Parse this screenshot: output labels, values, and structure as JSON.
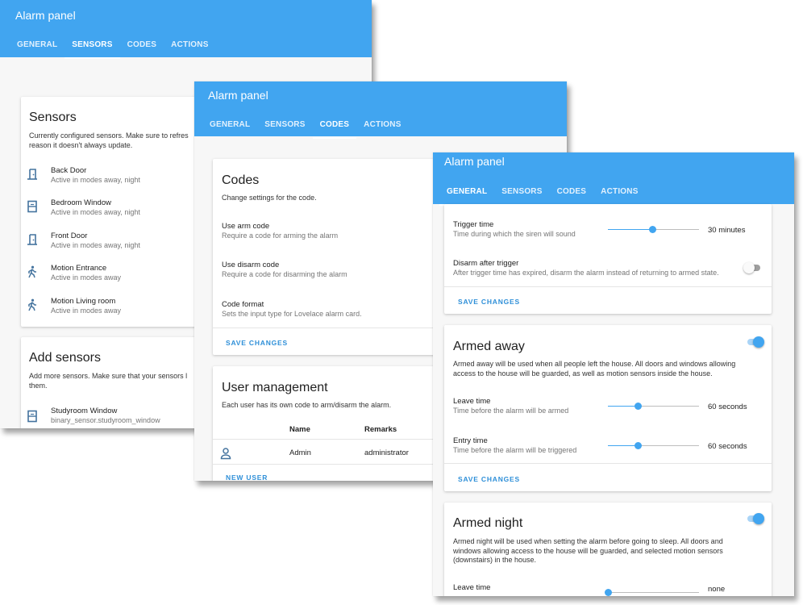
{
  "colors": {
    "primary": "#41a5f0",
    "accent": "#2e8fd8",
    "background": "#f7f7f7"
  },
  "sensors_window": {
    "title": "Alarm panel",
    "tabs": [
      "GENERAL",
      "SENSORS",
      "CODES",
      "ACTIONS"
    ],
    "active_tab": "SENSORS",
    "sensors_card": {
      "title": "Sensors",
      "description_1": "Currently configured sensors. Make sure to refres",
      "description_2": "reason it doesn't always update.",
      "items": [
        {
          "name": "Back Door",
          "info": "Active in modes away, night",
          "icon": "door-icon"
        },
        {
          "name": "Bedroom Window",
          "info": "Active in modes away, night",
          "icon": "window-icon"
        },
        {
          "name": "Front Door",
          "info": "Active in modes away, night",
          "icon": "door-icon"
        },
        {
          "name": "Motion Entrance",
          "info": "Active in modes away",
          "icon": "walk-icon"
        },
        {
          "name": "Motion Living room",
          "info": "Active in modes away",
          "icon": "walk-icon"
        }
      ]
    },
    "add_card": {
      "title": "Add sensors",
      "description_1": "Add more sensors. Make sure that your sensors l",
      "description_2": "them.",
      "items": [
        {
          "name": "Studyroom Window",
          "info": "binary_sensor.studyroom_window",
          "icon": "window-icon"
        }
      ]
    }
  },
  "codes_window": {
    "title": "Alarm panel",
    "tabs": [
      "GENERAL",
      "SENSORS",
      "CODES",
      "ACTIONS"
    ],
    "active_tab": "CODES",
    "codes_card": {
      "title": "Codes",
      "description": "Change settings for the code.",
      "rows": [
        {
          "title": "Use arm code",
          "sub": "Require a code for arming the alarm"
        },
        {
          "title": "Use disarm code",
          "sub": "Require a code for disarming the alarm"
        },
        {
          "title": "Code format",
          "sub": "Sets the input type for Lovelace alarm card."
        }
      ],
      "save_label": "SAVE CHANGES"
    },
    "users_card": {
      "title": "User management",
      "description": "Each user has its own code to arm/disarm the alarm.",
      "columns": [
        "Name",
        "Remarks"
      ],
      "rows": [
        {
          "name": "Admin",
          "remarks": "administrator",
          "icon": "account-icon"
        }
      ],
      "new_user_label": "NEW USER"
    }
  },
  "general_window": {
    "title": "Alarm panel",
    "tabs": [
      "GENERAL",
      "SENSORS",
      "CODES",
      "ACTIONS"
    ],
    "active_tab": "GENERAL",
    "trigger_card": {
      "trigger_time": {
        "title": "Trigger time",
        "sub": "Time during which the siren will sound",
        "value": "30 minutes",
        "fraction": 0.49
      },
      "disarm_after": {
        "title": "Disarm after trigger",
        "sub": "After trigger time has expired, disarm the alarm instead of returning to armed state.",
        "on": false
      },
      "save_label": "SAVE CHANGES"
    },
    "armed_away_card": {
      "title": "Armed away",
      "enabled": true,
      "description_1": "Armed away will be used when all people left the house. All doors and windows allowing",
      "description_2": "access to the house will be guarded, as well as motion sensors inside the house.",
      "leave_time": {
        "title": "Leave time",
        "sub": "Time before the alarm will be armed",
        "value": "60 seconds",
        "fraction": 0.33
      },
      "entry_time": {
        "title": "Entry time",
        "sub": "Time before the alarm will be triggered",
        "value": "60 seconds",
        "fraction": 0.33
      },
      "save_label": "SAVE CHANGES"
    },
    "armed_night_card": {
      "title": "Armed night",
      "enabled": true,
      "description_1": "Armed night will be used when setting the alarm before going to sleep. All doors and",
      "description_2": "windows allowing access to the house will be guarded, and selected motion sensors",
      "description_3": "(downstairs) in the house.",
      "leave_time": {
        "title": "Leave time",
        "value": "none",
        "fraction": 0.0
      }
    }
  }
}
